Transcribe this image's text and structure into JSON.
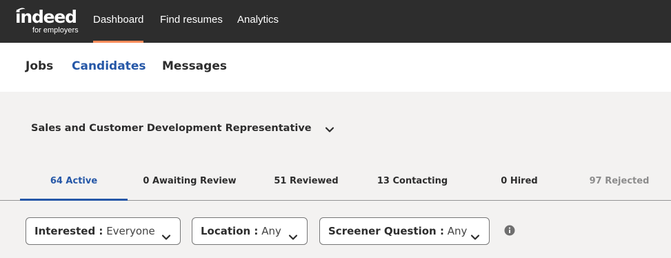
{
  "brand": {
    "logo_text": "indeed",
    "logo_subtext": "for employers",
    "colors": {
      "topbar": "#2d2d2d",
      "accent_orange": "#ff8c5a",
      "accent_blue": "#2557a7"
    }
  },
  "top_nav": {
    "items": [
      {
        "label": "Dashboard",
        "active": true
      },
      {
        "label": "Find resumes",
        "active": false
      },
      {
        "label": "Analytics",
        "active": false
      }
    ]
  },
  "sub_nav": {
    "items": [
      {
        "label": "Jobs",
        "active": false
      },
      {
        "label": "Candidates",
        "active": true
      },
      {
        "label": "Messages",
        "active": false
      }
    ]
  },
  "job_selector": {
    "title": "Sales and Customer Development Representative",
    "icon": "chevron-down-icon"
  },
  "status_tabs": [
    {
      "label": "64 Active",
      "active": true
    },
    {
      "label": "0 Awaiting Review",
      "active": false
    },
    {
      "label": "51 Reviewed",
      "active": false
    },
    {
      "label": "13 Contacting",
      "active": false
    },
    {
      "label": "0 Hired",
      "active": false
    },
    {
      "label": "97 Rejected",
      "active": false
    }
  ],
  "filters": [
    {
      "label": "Interested :",
      "value": "Everyone"
    },
    {
      "label": "Location :",
      "value": "Any"
    },
    {
      "label": "Screener Question :",
      "value": "Any"
    }
  ],
  "info": {
    "icon": "info-icon"
  }
}
